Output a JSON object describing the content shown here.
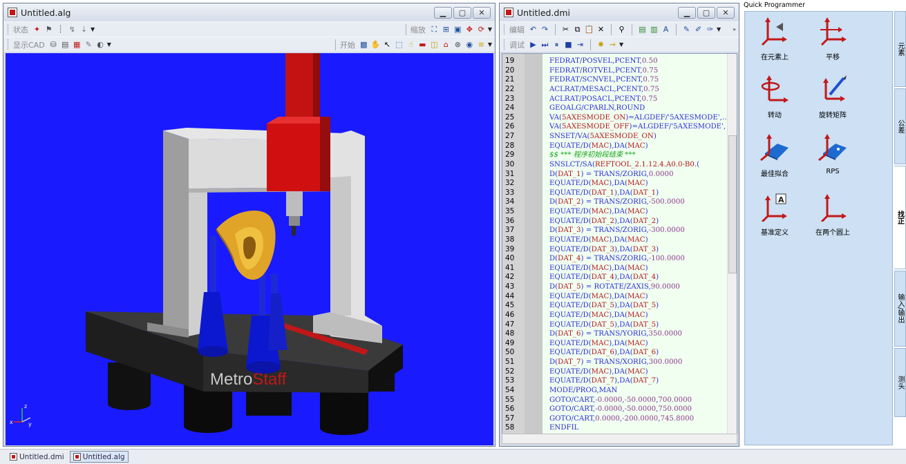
{
  "alg_window": {
    "title": "Untitled.alg",
    "toolbar1": {
      "label": "状态",
      "zoom_label": "缩放"
    },
    "toolbar2": {
      "label": "显示CAD",
      "start_label": "开始"
    },
    "viewport": {
      "brand_gray": "Metro",
      "brand_red": "Staff",
      "axis_x": "x",
      "axis_y": "y",
      "axis_z": "z"
    }
  },
  "dmi_window": {
    "title": "Untitled.dmi",
    "toolbar1": {
      "label": "编辑"
    },
    "toolbar2": {
      "label": "调试"
    },
    "code_lines": [
      {
        "n": "19",
        "t": "FEDRAT/POSVEL,PCENT,0.50"
      },
      {
        "n": "20",
        "t": "FEDRAT/ROTVEL,PCENT,0.75"
      },
      {
        "n": "21",
        "t": "FEDRAT/SCNVEL,PCENT,0.75"
      },
      {
        "n": "22",
        "t": "ACLRAT/MESACL,PCENT,0.75"
      },
      {
        "n": "23",
        "t": "ACLRAT/POSACL,PCENT,0.75"
      },
      {
        "n": "24",
        "t": "GEOALG/CPARLN,ROUND"
      },
      {
        "n": "25",
        "t": "VA(5AXESMODE_ON)=ALGDEF/'5AXESMODE',…"
      },
      {
        "n": "26",
        "t": "VA(5AXESMODE_OFF)=ALGDEF/'5AXESMODE',"
      },
      {
        "n": "27",
        "t": "SNSET/VA(5AXESMODE_ON)"
      },
      {
        "n": "28",
        "t": "EQUATE/D(MAC),DA(MAC)"
      },
      {
        "n": "29",
        "t": "$$ *** 程序初始段结束 ***"
      },
      {
        "n": "30",
        "t": "SNSLCT/SA(REFTOOL_2.1.12.4.A0.0-B0.("
      },
      {
        "n": "31",
        "t": "D(DAT_1) = TRANS/ZORIG,0.0000"
      },
      {
        "n": "32",
        "t": "EQUATE/D(MAC),DA(MAC)"
      },
      {
        "n": "33",
        "t": "EQUATE/D(DAT_1),DA(DAT_1)"
      },
      {
        "n": "34",
        "t": "D(DAT_2) = TRANS/ZORIG,-500.0000"
      },
      {
        "n": "35",
        "t": "EQUATE/D(MAC),DA(MAC)"
      },
      {
        "n": "36",
        "t": "EQUATE/D(DAT_2),DA(DAT_2)"
      },
      {
        "n": "37",
        "t": "D(DAT_3) = TRANS/ZORIG,-300.0000"
      },
      {
        "n": "38",
        "t": "EQUATE/D(MAC),DA(MAC)"
      },
      {
        "n": "39",
        "t": "EQUATE/D(DAT_3),DA(DAT_3)"
      },
      {
        "n": "40",
        "t": "D(DAT_4) = TRANS/ZORIG,-100.0000"
      },
      {
        "n": "41",
        "t": "EQUATE/D(MAC),DA(MAC)"
      },
      {
        "n": "42",
        "t": "EQUATE/D(DAT_4),DA(DAT_4)"
      },
      {
        "n": "43",
        "t": "D(DAT_5) = ROTATE/ZAXIS,90.0000"
      },
      {
        "n": "44",
        "t": "EQUATE/D(MAC),DA(MAC)"
      },
      {
        "n": "45",
        "t": "EQUATE/D(DAT_5),DA(DAT_5)"
      },
      {
        "n": "46",
        "t": "EQUATE/D(MAC),DA(MAC)"
      },
      {
        "n": "47",
        "t": "EQUATE/D(DAT_5),DA(DAT_5)"
      },
      {
        "n": "48",
        "t": "D(DAT_6) = TRANS/YORIG,350.0000"
      },
      {
        "n": "49",
        "t": "EQUATE/D(MAC),DA(MAC)"
      },
      {
        "n": "50",
        "t": "EQUATE/D(DAT_6),DA(DAT_6)"
      },
      {
        "n": "51",
        "t": "D(DAT_7) = TRANS/XORIG,300.0000"
      },
      {
        "n": "52",
        "t": "EQUATE/D(MAC),DA(MAC)"
      },
      {
        "n": "53",
        "t": "EQUATE/D(DAT_7),DA(DAT_7)"
      },
      {
        "n": "54",
        "t": "MODE/PROG,MAN"
      },
      {
        "n": "55",
        "t": "GOTO/CART,-0.0000,-50.0000,700.0000"
      },
      {
        "n": "56",
        "t": "GOTO/CART,-0.0000,-50.0000,750.0000"
      },
      {
        "n": "57",
        "t": "GOTO/CART,0.0000,-200.0000,745.8000"
      },
      {
        "n": "58",
        "t": "ENDFIL"
      }
    ]
  },
  "quick_programmer": {
    "title": "Quick Programmer",
    "items": [
      {
        "label": "在元素上",
        "icon": "axis-on-element-icon"
      },
      {
        "label": "平移",
        "icon": "translate-axis-icon"
      },
      {
        "label": "转动",
        "icon": "rotate-axis-icon"
      },
      {
        "label": "旋转矩阵",
        "icon": "rotation-matrix-icon"
      },
      {
        "label": "最佳拟合",
        "icon": "best-fit-icon"
      },
      {
        "label": "RPS",
        "icon": "rps-icon"
      },
      {
        "label": "基准定义",
        "icon": "datum-definition-icon"
      },
      {
        "label": "在两个圆上",
        "icon": "two-circles-icon"
      }
    ],
    "tabs": [
      "元素",
      "公差",
      "找正",
      "输入/输出",
      "测头"
    ],
    "active_tab": "找正"
  },
  "taskbar": {
    "items": [
      "Untitled.dmi",
      "Untitled.alg"
    ],
    "active": "Untitled.alg"
  },
  "colors": {
    "viewport_bg": "#1a1aff",
    "code_bg": "#f0fff0",
    "qp_bg": "#cde0f4",
    "label_red": "#b4151c",
    "keyword_blue": "#2b2bd9",
    "number_purple": "#8f3a8f",
    "comment_green": "#1ca31c"
  }
}
